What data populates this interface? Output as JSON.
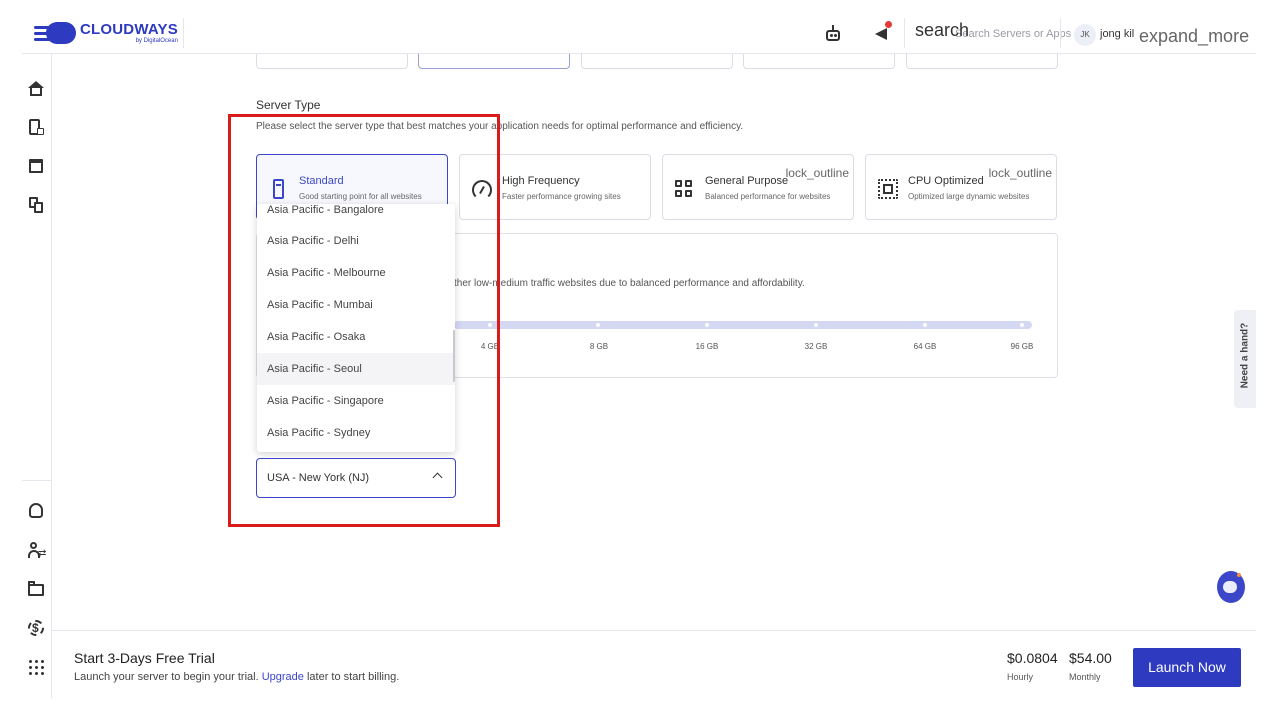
{
  "header": {
    "brand": "CLOUDWAYS",
    "brand_sub": "by DigitalOcean",
    "search_icon": "search",
    "search_placeholder": "Search Servers or Apps",
    "avatar_initials": "JK",
    "username": "jong kil",
    "expand_icon": "expand_more"
  },
  "server_type": {
    "title": "Server Type",
    "description": "Please select the server type that best matches your application needs for optimal performance and efficiency.",
    "cards": [
      {
        "name": "Standard",
        "desc": "Good starting point for all websites",
        "icon": "server-icon",
        "selected": true,
        "lock": ""
      },
      {
        "name": "High Frequency",
        "desc": "Faster performance growing sites",
        "icon": "speedometer-icon",
        "selected": false,
        "lock": ""
      },
      {
        "name": "General Purpose",
        "desc": "Balanced performance for websites",
        "icon": "grid-icon",
        "selected": false,
        "lock": "lock_outline"
      },
      {
        "name": "CPU Optimized",
        "desc": "Optimized large dynamic websites",
        "icon": "cpu-icon",
        "selected": false,
        "lock": "lock_outline"
      }
    ]
  },
  "server_size": {
    "description": "ther low-medium traffic websites due to balanced performance and affordability.",
    "sizes": [
      "4 GB",
      "8 GB",
      "16 GB",
      "32 GB",
      "64 GB",
      "96 GB"
    ]
  },
  "location": {
    "options": [
      "Asia Pacific - Bangalore",
      "Asia Pacific - Delhi",
      "Asia Pacific - Melbourne",
      "Asia Pacific - Mumbai",
      "Asia Pacific - Osaka",
      "Asia Pacific - Seoul",
      "Asia Pacific - Singapore",
      "Asia Pacific - Sydney"
    ],
    "hovered": "Asia Pacific - Seoul",
    "selected": "USA - New York (NJ)"
  },
  "help": {
    "label": "Need a hand?"
  },
  "footer": {
    "title": "Start 3-Days Free Trial",
    "sub_before": "Launch your server to begin your trial. ",
    "sub_link": "Upgrade",
    "sub_after": " later to start billing.",
    "hourly_price": "$0.0804",
    "hourly_label": "Hourly",
    "monthly_price": "$54.00",
    "monthly_label": "Monthly",
    "launch_label": "Launch Now"
  },
  "colors": {
    "accent": "#2e3ac0",
    "highlight": "#d91b1b",
    "notification_dot": "#e53935"
  }
}
